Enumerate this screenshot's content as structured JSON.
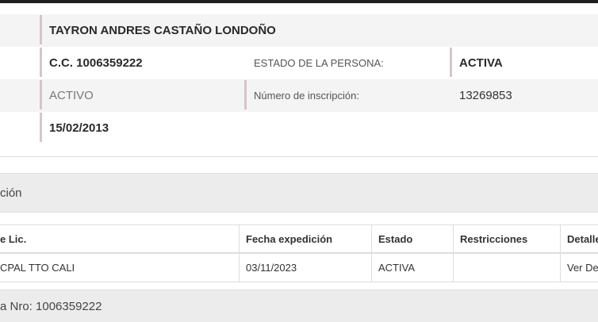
{
  "person": {
    "full_name": "TAYRON ANDRES CASTAÑO LONDOÑO",
    "document": "C.C. 1006359222",
    "estado_label": "ESTADO DE LA PERSONA:",
    "estado_value": "ACTIVA",
    "status": "ACTIVO",
    "inscripcion_label": "Número de inscripción:",
    "inscripcion_value": "13269853",
    "date": "15/02/2013"
  },
  "section_title": "ción",
  "licenses_table": {
    "headers": [
      "e Lic.",
      "Fecha expedición",
      "Estado",
      "Restricciones",
      "Detalle"
    ],
    "rows": [
      [
        "CPAL TTO CALI",
        "03/11/2023",
        "ACTIVA",
        "",
        "Ver De"
      ]
    ]
  },
  "footer_section_title": "a Nro: 1006359222",
  "colors": {
    "accent_bar": "#d7c5c7",
    "row_shade": "#f4f4f4",
    "section_bg": "#ececec",
    "top_bar": "#1f1f1f"
  }
}
